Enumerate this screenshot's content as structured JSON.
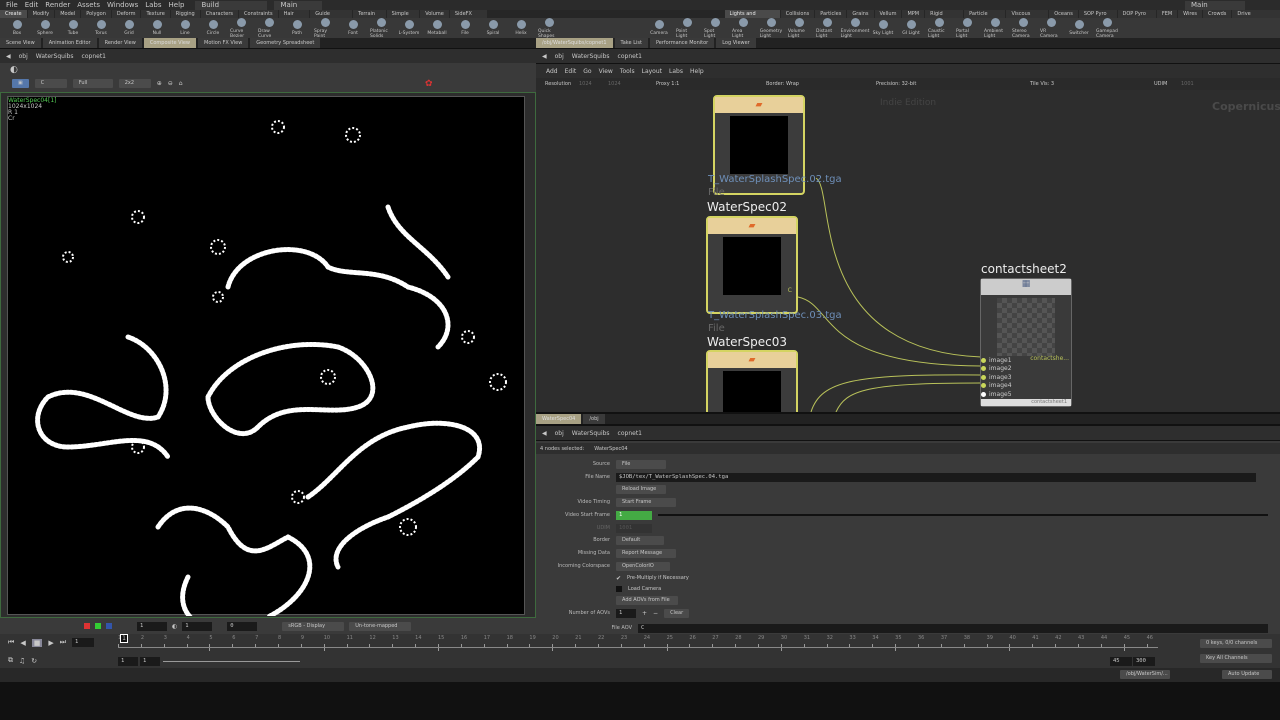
{
  "menubar": {
    "items": [
      "File",
      "Edit",
      "Render",
      "Assets",
      "Windows",
      "Labs",
      "Help"
    ],
    "desktop": "Build",
    "layout": "Main",
    "right_layout": "Main"
  },
  "shelf_left": {
    "tabs": [
      "Create",
      "Modify",
      "Model",
      "Polygon",
      "Deform",
      "Texture",
      "Rigging",
      "Characters",
      "Constraints",
      "Hair Utils",
      "Guide Process",
      "Terrain FX",
      "Simple FX",
      "Volume",
      "SideFX Labs"
    ],
    "tools": [
      "Box",
      "Sphere",
      "Tube",
      "Torus",
      "Grid",
      "Null",
      "Line",
      "Circle",
      "Curve Bezier",
      "Draw Curve",
      "Path",
      "Spray Paint",
      "Font",
      "Platonic Solids",
      "L-System",
      "Metaball",
      "File",
      "Spiral",
      "Helix",
      "Quick Shapes"
    ]
  },
  "shelf_right": {
    "tabs": [
      "Lights and Cameras",
      "Collisions",
      "Particles",
      "Grains",
      "Vellum",
      "MPM",
      "Rigid Bodies",
      "Particle Fluids",
      "Viscous Fluids",
      "Oceans",
      "SOP Pyro FX",
      "DOP Pyro FX",
      "FEM",
      "Wires",
      "Crowds",
      "Drive Simulation"
    ],
    "tools": [
      "Camera",
      "Point Light",
      "Spot Light",
      "Area Light",
      "Geometry Light",
      "Volume Light",
      "Distant Light",
      "Environment Light",
      "Sky Light",
      "GI Light",
      "Caustic Light",
      "Portal Light",
      "Ambient Light",
      "Stereo Camera",
      "VR Camera",
      "Switcher",
      "Gamepad Camera"
    ]
  },
  "left_pane": {
    "tabs": [
      "Scene View",
      "Animation Editor",
      "Render View",
      "Composite View",
      "Motion FX View",
      "Geometry Spreadsheet"
    ],
    "active_tab": 3,
    "path": [
      "obj",
      "WaterSquibs",
      "copnet1"
    ],
    "toolbar": {
      "plane": "C",
      "resolution": "Full",
      "grid": "2x2"
    },
    "viewer": {
      "image_name": "WaterSpec04[1]",
      "size": "1024x1024",
      "line2": "R 1",
      "line3": "Cr"
    },
    "bottom": {
      "exposure": "1",
      "gamma": "1",
      "offset": "0",
      "display": "sRGB - Display",
      "tonemap": "Un-tone-mapped"
    }
  },
  "network_pane": {
    "tabs": [
      "/obj/WaterSquibs/copnet1",
      "Take List",
      "Performance Monitor",
      "Log Viewer"
    ],
    "path": [
      "obj",
      "WaterSquibs",
      "copnet1"
    ],
    "menu": [
      "Add",
      "Edit",
      "Go",
      "View",
      "Tools",
      "Layout",
      "Labs",
      "Help"
    ],
    "params": {
      "resolution": "Resolution",
      "res_x": "1024",
      "res_y": "1024",
      "proxy": "Proxy 1:1",
      "border": "Border: Wrap",
      "precision": "Precision: 32-bit",
      "tile_vis": "Tile Vis: 3",
      "udim": "UDIM",
      "udim_val": "1001"
    },
    "watermark": "Indie Edition",
    "context": "Copernicus",
    "nodes": [
      {
        "file": "T_WaterSplashSpec.02.tga",
        "type": "File",
        "name": "WaterSpec02"
      },
      {
        "file": "T_WaterSplashSpec.03.tga",
        "type": "File",
        "name": "WaterSpec03"
      }
    ],
    "contact": {
      "name": "contactsheet2",
      "inputs": [
        "image1",
        "image2",
        "image3",
        "image4",
        "image5"
      ],
      "output": "contactshe...",
      "footer": "contactsheet1"
    },
    "port_label": "C"
  },
  "param_pane": {
    "tabs": [
      "WaterSpec04",
      "/obj"
    ],
    "path": [
      "obj",
      "WaterSquibs",
      "copnet1"
    ],
    "selected_label": "4 nodes selected:",
    "selected_node": "WaterSpec04",
    "fields": {
      "source_label": "Source",
      "source": "File",
      "filename_label": "File Name",
      "filename": "$JOB/tex/T_WaterSplashSpec.04.tga",
      "reload": "Reload Image",
      "timing_label": "Video Timing",
      "timing": "Start Frame",
      "start_label": "Video Start Frame",
      "start": "1",
      "udim_label": "UDIM",
      "udim": "1001",
      "border_label": "Border",
      "border": "Default",
      "missing_label": "Missing Data",
      "missing": "Report Message",
      "colorspace_label": "Incoming Colorspace",
      "colorspace": "OpenColorIO",
      "premult": "Pre-Multiply if Necessary",
      "loadcam": "Load Camera",
      "add_aovs": "Add AOVs from File",
      "num_aovs_label": "Number of AOVs",
      "num_aovs": "1",
      "clear": "Clear",
      "file_aov_label": "File AOV",
      "file_aov": "C"
    }
  },
  "timeline": {
    "frame": "1",
    "ticks": [
      "1",
      "2",
      "3",
      "4",
      "5",
      "6",
      "7",
      "8",
      "9",
      "10",
      "11",
      "12",
      "13",
      "14",
      "15",
      "16",
      "17",
      "18",
      "19",
      "20",
      "21",
      "22",
      "23",
      "24",
      "25",
      "26",
      "27",
      "28",
      "29",
      "30",
      "31",
      "32",
      "33",
      "34",
      "35",
      "36",
      "37",
      "38",
      "39",
      "40",
      "41",
      "42",
      "43",
      "44",
      "45",
      "46"
    ],
    "range_start": "1",
    "range_start2": "1",
    "end": "45",
    "end2": "300",
    "keys": "0 keys, 0/0 channels",
    "key_all": "Key All Channels"
  },
  "status": {
    "path": "/obj/WaterSim/...",
    "update": "Auto Update"
  }
}
